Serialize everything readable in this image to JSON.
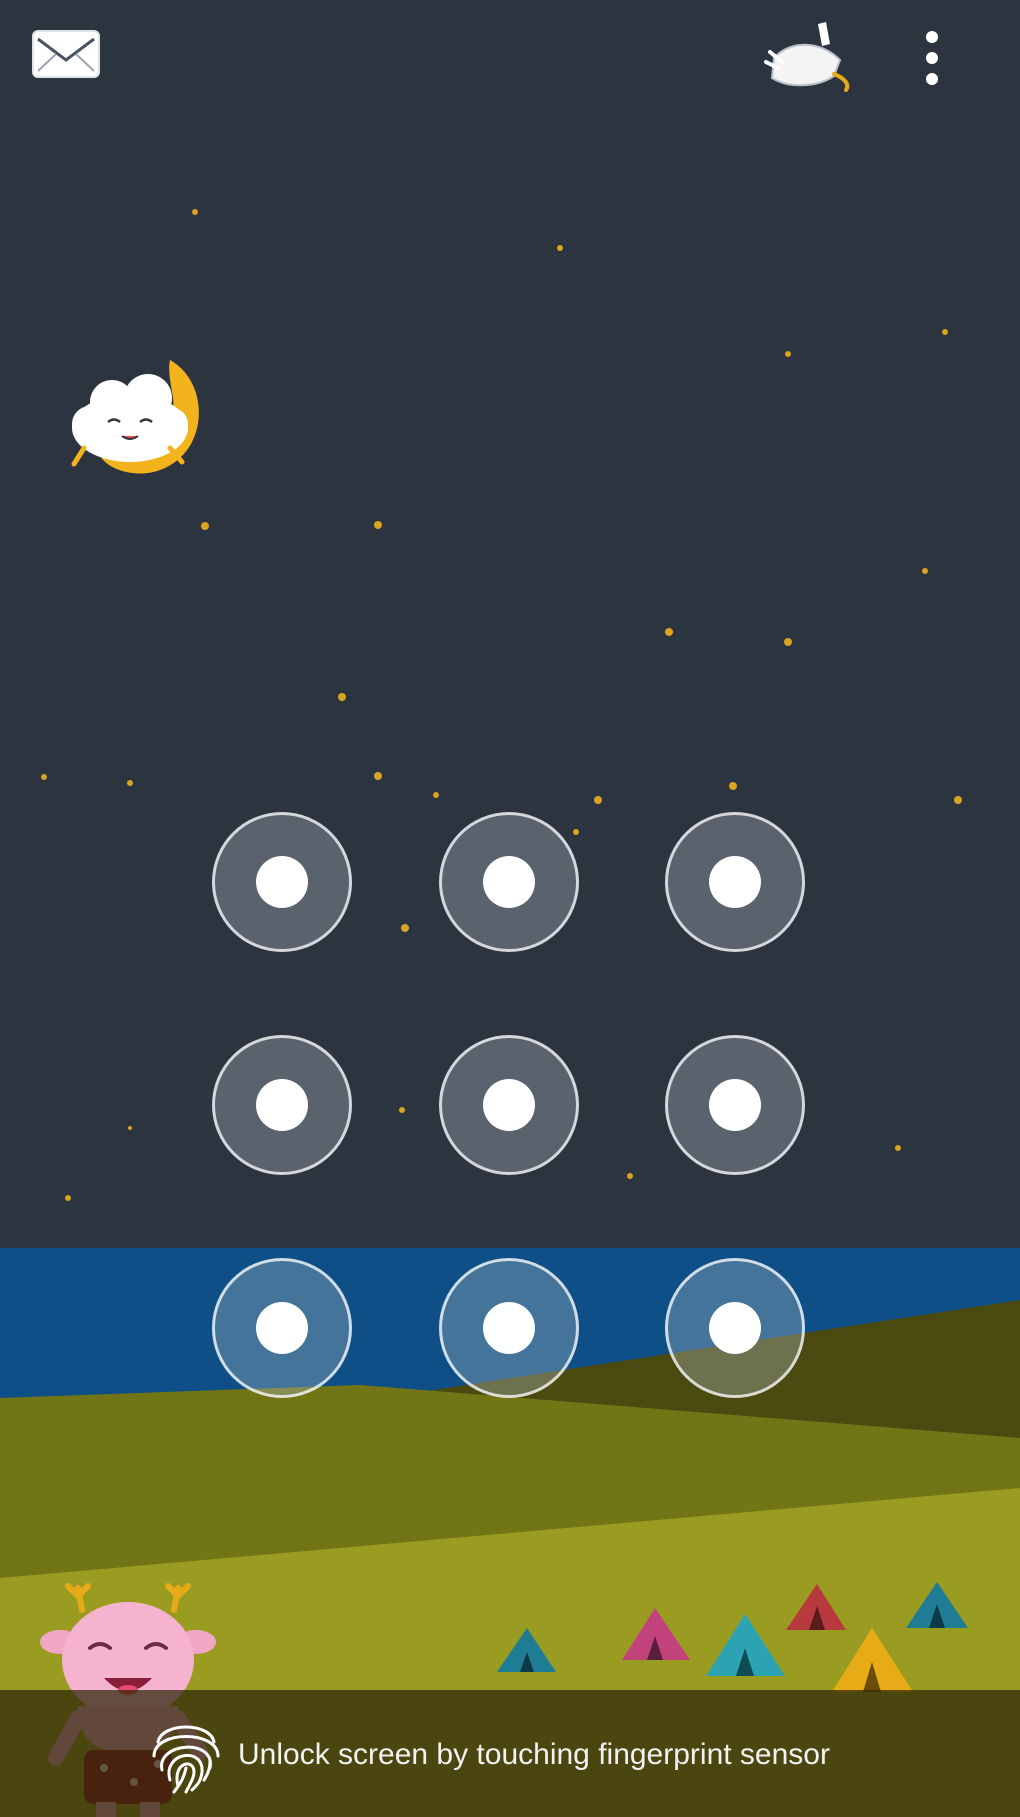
{
  "status_bar": {
    "mail_icon": "envelope-icon",
    "theme_icon": "paintbrush-icon",
    "menu_icon": "overflow-menu-icon"
  },
  "pattern_lock": {
    "rows": 3,
    "columns": 3,
    "dot_count": 9
  },
  "footer": {
    "fingerprint_icon": "fingerprint-icon",
    "hint": "Unlock screen by touching fingerprint sensor"
  },
  "colors": {
    "sky": "#2c3440",
    "lake": "#0d4f86",
    "hill_dark": "#4b4a10",
    "hill_mid": "#727516",
    "hill_light": "#9a9c22",
    "star": "#d9a520"
  }
}
